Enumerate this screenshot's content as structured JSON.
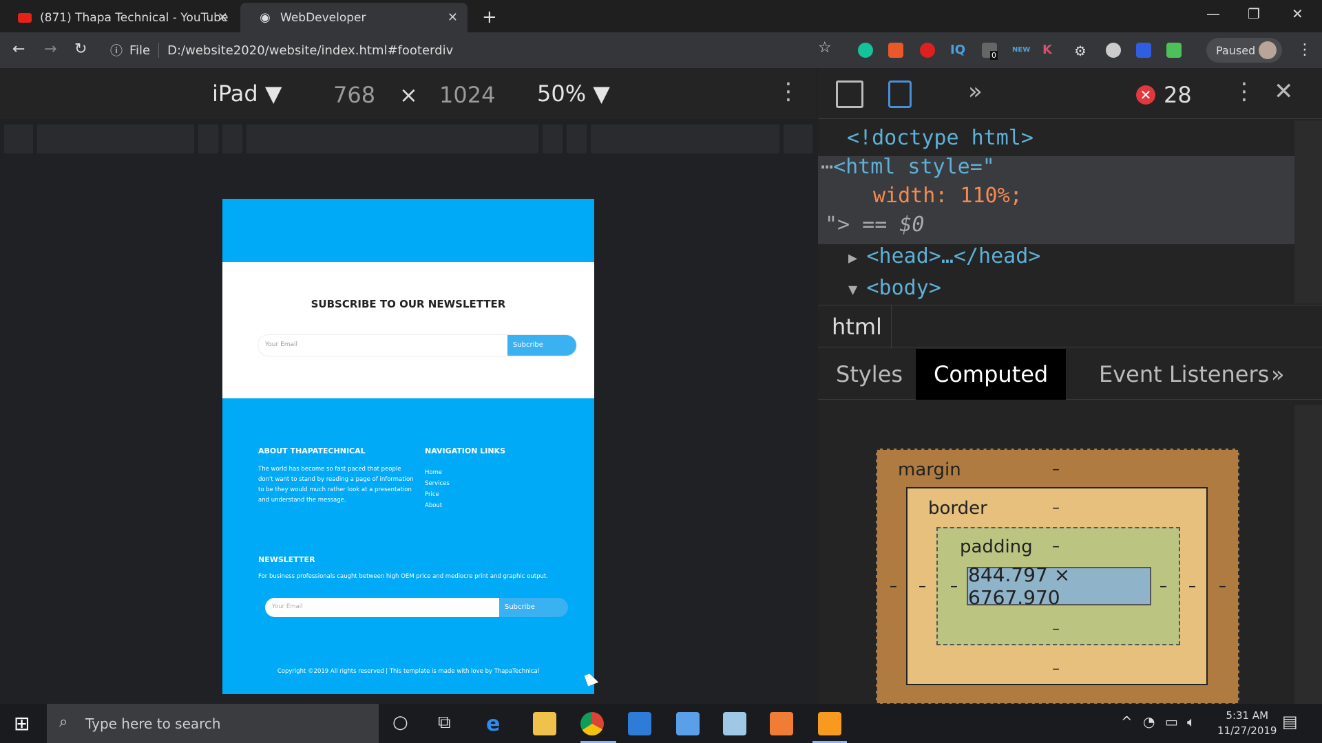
{
  "browser": {
    "tabs": [
      {
        "title": "(871) Thapa Technical - YouTube",
        "icon": "youtube-icon",
        "active": false
      },
      {
        "title": "WebDeveloper",
        "icon": "globe-icon",
        "active": true
      }
    ],
    "new_tab": "+",
    "address": {
      "scheme_label": "File",
      "url": "D:/website2020/website/index.html#footerdiv"
    },
    "profile_status": "Paused",
    "extension_badge": "0",
    "extension_new_label": "NEW"
  },
  "device_toolbar": {
    "device": "iPad",
    "width": "768",
    "times": "×",
    "height": "1024",
    "zoom": "50%"
  },
  "preview": {
    "newsletter_title": "SUBSCRIBE TO OUR NEWSLETTER",
    "email_placeholder": "Your Email",
    "subscribe_label": "Subcribe",
    "about_heading": "ABOUT THAPATECHNICAL",
    "about_text": "The world has become so fast paced that people don't want to stand by reading a page of information to be they would much rather look at a presentation and understand the message.",
    "nav_heading": "NAVIGATION LINKS",
    "nav_links": [
      "Home",
      "Services",
      "Price",
      "About"
    ],
    "footer_newsletter_heading": "NEWSLETTER",
    "footer_newsletter_text": "For business professionals caught between high OEM price and mediocre print and graphic output.",
    "footer_email_placeholder": "Your Email",
    "footer_subscribe_label": "Subcribe",
    "copyright": "Copyright ©2019 All rights reserved | This template is made with love by ThapaTechnical"
  },
  "devtools": {
    "error_count": "28",
    "dom": {
      "doctype": "<!doctype html>",
      "html_open": "<html style=\"",
      "style_value": "width: 110%;",
      "html_close": "\"> == $0",
      "head": "<head>…</head>",
      "body": "<body>"
    },
    "breadcrumb": "html",
    "panel_tabs": [
      "Styles",
      "Computed",
      "Event Listeners"
    ],
    "more": "»",
    "box_model": {
      "margin_label": "margin",
      "border_label": "border",
      "padding_label": "padding",
      "content_size": "844.797 × 6767.970",
      "empty": "–"
    }
  },
  "taskbar": {
    "search_placeholder": "Type here to search",
    "time": "5:31 AM",
    "date": "11/27/2019"
  },
  "colors": {
    "accent_blue": "#00aaf7",
    "devtools_bg": "#242424",
    "error_red": "#e0383e"
  }
}
